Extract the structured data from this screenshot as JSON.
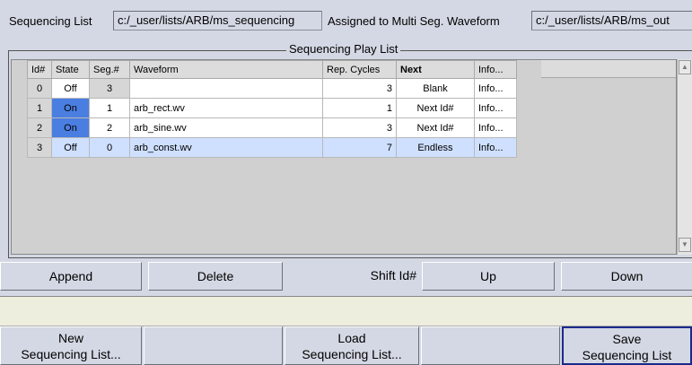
{
  "header": {
    "seq_list_label": "Sequencing List",
    "seq_list_value": "c:/_user/lists/ARB/ms_sequencing",
    "assigned_label": "Assigned to Multi Seg. Waveform",
    "assigned_value": "c:/_user/lists/ARB/ms_out"
  },
  "play_list": {
    "title": "Sequencing Play List",
    "columns": [
      "Id#",
      "State",
      "Seg.#",
      "Waveform",
      "Rep. Cycles",
      "Next",
      "Info..."
    ],
    "rows": [
      {
        "id": "0",
        "state": "Off",
        "seg": "3",
        "waveform": "",
        "rep": "3",
        "next": "Blank",
        "info": "Info..."
      },
      {
        "id": "1",
        "state": "On",
        "seg": "1",
        "waveform": "arb_rect.wv",
        "rep": "1",
        "next": "Next Id#",
        "info": "Info..."
      },
      {
        "id": "2",
        "state": "On",
        "seg": "2",
        "waveform": "arb_sine.wv",
        "rep": "3",
        "next": "Next Id#",
        "info": "Info..."
      },
      {
        "id": "3",
        "state": "Off",
        "seg": "0",
        "waveform": "arb_const.wv",
        "rep": "7",
        "next": "Endless",
        "info": "Info..."
      }
    ]
  },
  "actions": {
    "append": "Append",
    "delete": "Delete",
    "shift_label": "Shift Id#",
    "up": "Up",
    "down": "Down"
  },
  "bottom": {
    "new_line1": "New",
    "new_line2": "Sequencing List...",
    "load_line1": "Load",
    "load_line2": "Sequencing List...",
    "save_line1": "Save",
    "save_line2": "Sequencing List"
  },
  "colors": {
    "background": "#d4d8e4",
    "state_on": "#4a7ee0",
    "selected_row": "#cfe0ff",
    "save_border": "#1a2a8a"
  }
}
